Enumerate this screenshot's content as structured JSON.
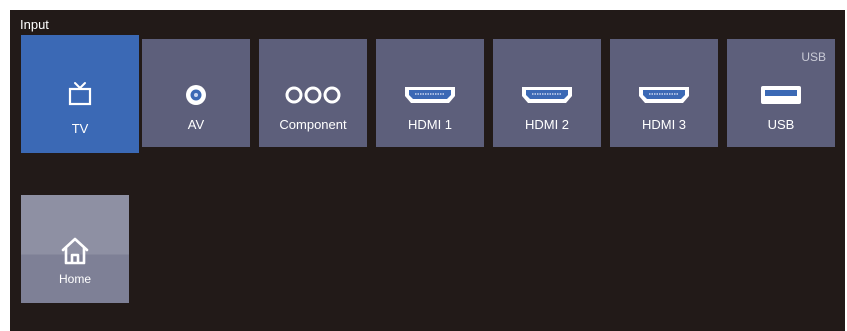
{
  "header": {
    "title": "Input"
  },
  "sources": [
    {
      "label": "TV",
      "icon": "tv-icon",
      "selected": true
    },
    {
      "label": "AV",
      "icon": "av-jack-icon",
      "selected": false
    },
    {
      "label": "Component",
      "icon": "component-icon",
      "selected": false
    },
    {
      "label": "HDMI 1",
      "icon": "hdmi-icon",
      "selected": false
    },
    {
      "label": "HDMI 2",
      "icon": "hdmi-icon",
      "selected": false
    },
    {
      "label": "HDMI 3",
      "icon": "hdmi-icon",
      "selected": false
    },
    {
      "label": "USB",
      "icon": "usb-icon",
      "selected": false,
      "corner": "USB"
    }
  ],
  "shortcuts": [
    {
      "label": "Home",
      "icon": "home-icon"
    }
  ],
  "colors": {
    "background": "#221a18",
    "tile": "#5d5f7b",
    "selected_tile": "#3b69b5",
    "home_tile": "#8e90a3",
    "text": "#ffffff"
  }
}
